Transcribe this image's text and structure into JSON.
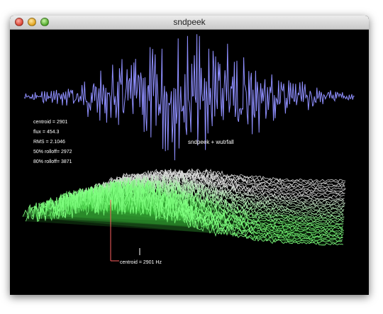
{
  "window": {
    "title": "sndpeek"
  },
  "stats": {
    "centroid": "centroid  =  2901",
    "flux": "flux  =  454.3",
    "rms": "RMS  =  2.1046",
    "rolloff50": "50% rolloff=  2972",
    "rolloff80": "80% rolloff=  3871"
  },
  "labels": {
    "app": "sndpeek  +  wutrfall",
    "centroid_readout": "centroid  =  2901  Hz"
  },
  "colors": {
    "background": "#000000",
    "waveform": "#8f8fff",
    "waterfall_front": "#80ff80",
    "waterfall_back": "#d8d8d8",
    "marker": "#ff6060"
  }
}
